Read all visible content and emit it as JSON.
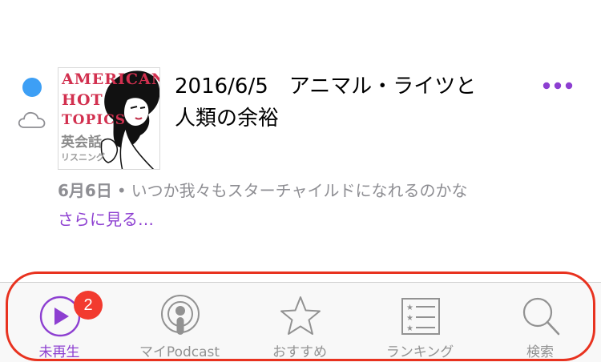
{
  "colors": {
    "accent": "#8d3fd1",
    "unplayed_dot": "#3d9ff5",
    "badge": "#f23a2f",
    "inactive": "#929292",
    "annotation": "#e8321f"
  },
  "episode": {
    "artwork": {
      "line1": "AMERICAN",
      "line2": "HOT",
      "line3": "TOPICS",
      "jp": "英会話",
      "jp_sub": "リスニング"
    },
    "title": "2016/6/5　アニマル・ライツと人類の余裕",
    "date": "6月6日",
    "separator": "•",
    "description": "いつか我々もスターチャイルドになれるのかな",
    "see_more": "さらに見る…",
    "more_icon": "ellipsis-icon",
    "download_icon": "cloud-icon"
  },
  "tabbar": {
    "tabs": [
      {
        "label": "未再生",
        "icon": "play-circle-icon",
        "active": true,
        "badge": "2"
      },
      {
        "label": "マイPodcast",
        "icon": "podcast-icon",
        "active": false
      },
      {
        "label": "おすすめ",
        "icon": "star-icon",
        "active": false
      },
      {
        "label": "ランキング",
        "icon": "list-icon",
        "active": false
      },
      {
        "label": "検索",
        "icon": "search-icon",
        "active": false
      }
    ]
  }
}
